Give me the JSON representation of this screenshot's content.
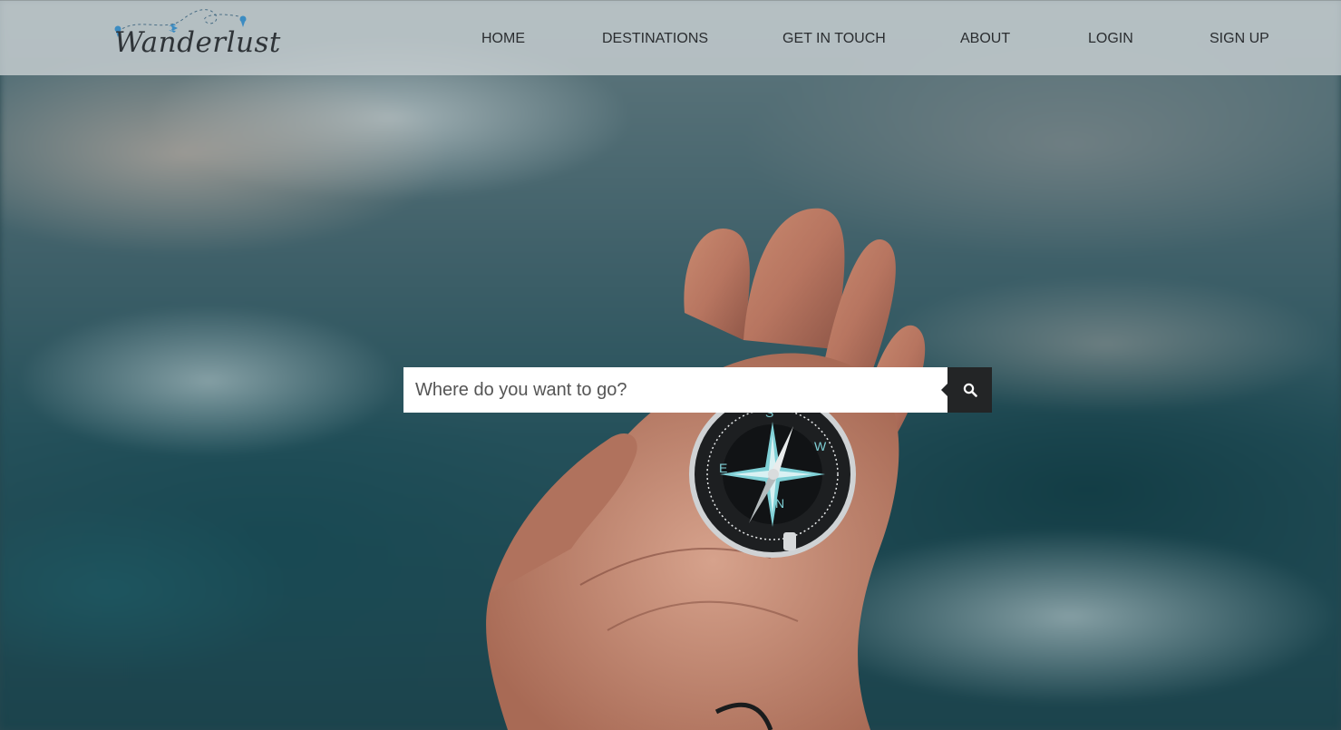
{
  "header": {
    "logo_text": "Wanderlust",
    "nav": [
      {
        "label": "HOME"
      },
      {
        "label": "DESTINATIONS"
      },
      {
        "label": "GET IN TOUCH"
      },
      {
        "label": "ABOUT"
      },
      {
        "label": "LOGIN"
      },
      {
        "label": "SIGN UP"
      }
    ]
  },
  "search": {
    "placeholder": "Where do you want to go?",
    "value": "",
    "button_icon": "search-icon"
  },
  "hero": {
    "image": "hand-holding-compass-over-sea"
  },
  "colors": {
    "header_bg": "#cdd4d6",
    "nav_text": "#2a2d30",
    "search_button_bg": "#232526",
    "search_input_bg": "#ffffff"
  }
}
